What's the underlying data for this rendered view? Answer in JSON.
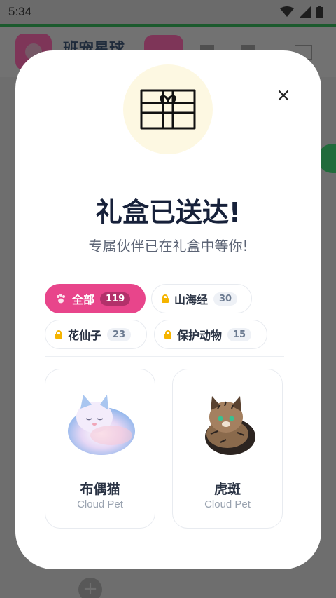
{
  "status_bar": {
    "time": "5:34"
  },
  "app": {
    "title": "班宠星球"
  },
  "modal": {
    "title": "礼盒已送达!",
    "subtitle": "专属伙伴已在礼盒中等你!",
    "filters": [
      {
        "label": "全部",
        "count": "119",
        "active": true,
        "icon": "paw-icon"
      },
      {
        "label": "山海经",
        "count": "30",
        "active": false,
        "icon": "lock-icon"
      },
      {
        "label": "花仙子",
        "count": "23",
        "active": false,
        "icon": "lock-icon"
      },
      {
        "label": "保护动物",
        "count": "15",
        "active": false,
        "icon": "lock-icon"
      }
    ],
    "pets": [
      {
        "name": "布偶猫",
        "subtitle": "Cloud Pet"
      },
      {
        "name": "虎斑",
        "subtitle": "Cloud Pet"
      }
    ]
  },
  "colors": {
    "accent": "#e8458b",
    "title": "#17213a",
    "gift_bg": "#fdf8e2",
    "lock": "#f5b400"
  }
}
